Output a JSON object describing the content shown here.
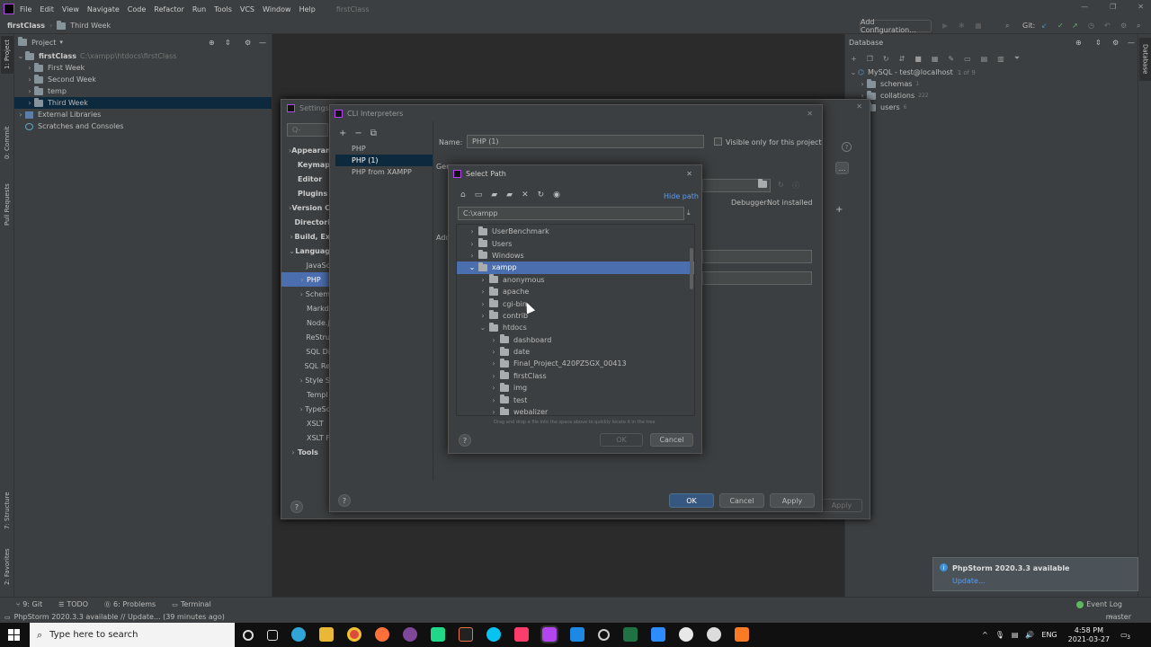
{
  "menu": {
    "items": [
      "File",
      "Edit",
      "View",
      "Navigate",
      "Code",
      "Refactor",
      "Run",
      "Tools",
      "VCS",
      "Window",
      "Help"
    ],
    "project_title": "firstClass"
  },
  "navbar": {
    "crumb1": "firstClass",
    "crumb2": "Third Week",
    "add_config": "Add Configuration...",
    "git_label": "Git:"
  },
  "project_panel": {
    "title": "Project",
    "root": "firstClass",
    "root_path": "C:\\xampp\\htdocs\\firstClass",
    "items": [
      {
        "label": "First Week"
      },
      {
        "label": "Second Week"
      },
      {
        "label": "temp"
      },
      {
        "label": "Third Week"
      }
    ],
    "external": "External Libraries",
    "scratches": "Scratches and Consoles"
  },
  "left_strip": {
    "project": "1: Project",
    "commit": "0: Commit",
    "pull": "Pull Requests",
    "structure": "7: Structure",
    "favorites": "2: Favorites"
  },
  "database_panel": {
    "title": "Database",
    "source": "MySQL - test@localhost",
    "source_count": "1 of 9",
    "items": [
      {
        "label": "schemas",
        "count": "1"
      },
      {
        "label": "collations",
        "count": "222"
      },
      {
        "label": "users",
        "count": "6"
      }
    ],
    "strip_label": "Database"
  },
  "settings_dialog": {
    "title": "Settings",
    "search_placeholder": "Q-",
    "items": [
      {
        "label": "Appearance"
      },
      {
        "label": "Keymap"
      },
      {
        "label": "Editor"
      },
      {
        "label": "Plugins"
      },
      {
        "label": "Version C"
      },
      {
        "label": "Directori"
      },
      {
        "label": "Build, Ex"
      },
      {
        "label": "Languag"
      },
      {
        "label": "JavaSc"
      },
      {
        "label": "PHP"
      },
      {
        "label": "Schem"
      },
      {
        "label": "Markd"
      },
      {
        "label": "Node.j"
      },
      {
        "label": "ReStru"
      },
      {
        "label": "SQL Di"
      },
      {
        "label": "SQL Re"
      },
      {
        "label": "Style S"
      },
      {
        "label": "Templ"
      },
      {
        "label": "TypeSc"
      },
      {
        "label": "XSLT"
      },
      {
        "label": "XSLT F"
      },
      {
        "label": "Tools"
      }
    ],
    "apply": "Apply"
  },
  "cli_dialog": {
    "title": "CLI Interpreters",
    "list": [
      "PHP",
      "PHP (1)",
      "PHP from XAMPP"
    ],
    "name_label": "Name:",
    "name_value": "PHP (1)",
    "visible_only": "Visible only for this project",
    "general_label": "Gen",
    "additional_label": "Add",
    "debugger_label": "Debugger:",
    "debugger_value": "Not installed",
    "ok": "OK",
    "cancel": "Cancel",
    "apply": "Apply"
  },
  "select_path": {
    "title": "Select Path",
    "hide_path": "Hide path",
    "path_value": "C:\\xampp",
    "tree": [
      {
        "label": "UserBenchmark"
      },
      {
        "label": "Users"
      },
      {
        "label": "Windows"
      },
      {
        "label": "xampp"
      },
      {
        "label": "anonymous"
      },
      {
        "label": "apache"
      },
      {
        "label": "cgi-bin"
      },
      {
        "label": "contrib"
      },
      {
        "label": "htdocs"
      },
      {
        "label": "dashboard"
      },
      {
        "label": "date"
      },
      {
        "label": "Final_Project_420PZ5GX_00413"
      },
      {
        "label": "firstClass"
      },
      {
        "label": "img"
      },
      {
        "label": "test"
      },
      {
        "label": "webalizer"
      }
    ],
    "hint": "Drag and drop a file into the space above to quickly locate it in the tree",
    "ok": "OK",
    "cancel": "Cancel"
  },
  "notification": {
    "title": "PhpStorm 2020.3.3 available",
    "link": "Update..."
  },
  "bottom_tabs": [
    "9: Git",
    "TODO",
    "6: Problems",
    "Terminal"
  ],
  "event_log": "Event Log",
  "status": {
    "message": "PhpStorm 2020.3.3 available // Update... (39 minutes ago)",
    "branch": "master"
  },
  "taskbar": {
    "search_placeholder": "Type here to search",
    "lang": "ENG",
    "time": "4:58 PM",
    "date": "2021-03-27",
    "notif_count": "3"
  },
  "colors": {
    "accent": "#4b6eaf",
    "selection": "#0d293e",
    "primary_button": "#365880"
  }
}
